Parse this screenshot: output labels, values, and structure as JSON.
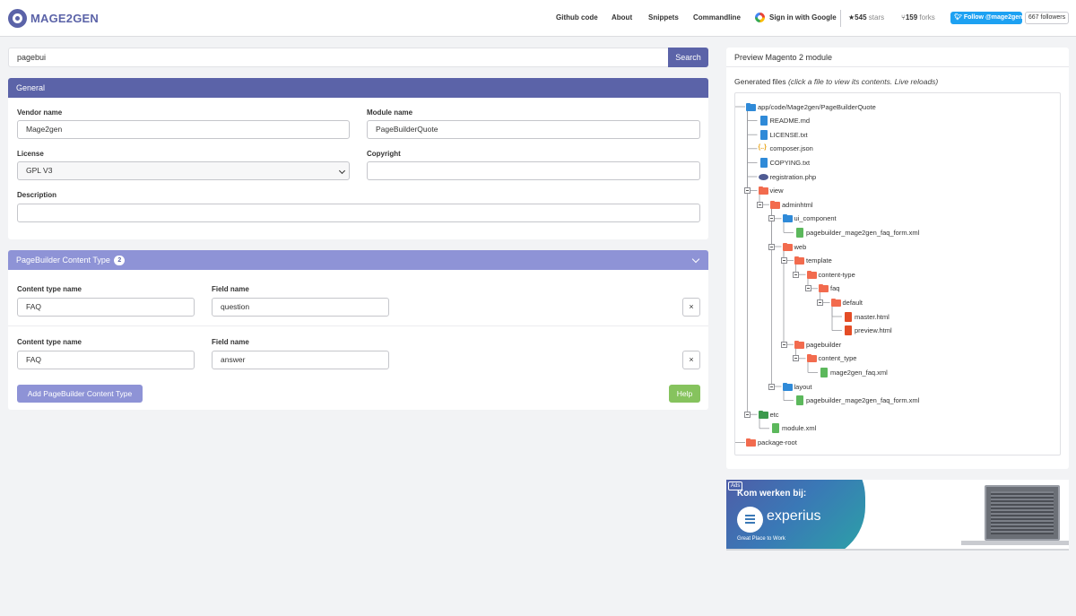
{
  "navbar": {
    "brand": "MAGE2GEN",
    "links": [
      "Github code",
      "About",
      "Snippets",
      "Commandline"
    ],
    "google_signin": "Sign in with Google",
    "stars_count": "545",
    "stars_label": "stars",
    "forks_count": "159",
    "forks_label": "forks",
    "twitter_follow": "Follow @mage2gen",
    "followers": "667 followers"
  },
  "search": {
    "value": "pagebui",
    "button": "Search"
  },
  "general": {
    "title": "General",
    "vendor_label": "Vendor name",
    "vendor_value": "Mage2gen",
    "module_label": "Module name",
    "module_value": "PageBuilderQuote",
    "license_label": "License",
    "license_value": "GPL V3",
    "copyright_label": "Copyright",
    "copyright_value": "",
    "description_label": "Description",
    "description_value": ""
  },
  "pagebuilder": {
    "title": "PageBuilder Content Type",
    "count": "2",
    "rows": [
      {
        "content_type_label": "Content type name",
        "content_type_value": "FAQ",
        "field_label": "Field name",
        "field_value": "question",
        "remove": "×"
      },
      {
        "content_type_label": "Content type name",
        "content_type_value": "FAQ",
        "field_label": "Field name",
        "field_value": "answer",
        "remove": "×"
      }
    ],
    "add_button": "Add PageBuilder Content Type",
    "help_button": "Help"
  },
  "preview": {
    "title": "Preview Magento 2 module",
    "generated_prefix": "Generated files",
    "generated_hint": "(click a file to view its contents. Live reloads)",
    "tree": [
      {
        "name": "app/code/Mage2gen/PageBuilderQuote",
        "icon": "folder-blue-icon"
      },
      {
        "name": "README.md",
        "icon": "file-icon"
      },
      {
        "name": "LICENSE.txt",
        "icon": "file-icon"
      },
      {
        "name": "composer.json",
        "icon": "json-file-icon"
      },
      {
        "name": "COPYING.txt",
        "icon": "file-icon"
      },
      {
        "name": "registration.php",
        "icon": "php-file-icon"
      },
      {
        "name": "view",
        "icon": "folder-orange-icon"
      },
      {
        "name": "adminhtml",
        "icon": "folder-orange-icon"
      },
      {
        "name": "ui_component",
        "icon": "folder-blue-icon"
      },
      {
        "name": "pagebuilder_mage2gen_faq_form.xml",
        "icon": "xml-file-icon"
      },
      {
        "name": "web",
        "icon": "folder-orange-icon"
      },
      {
        "name": "template",
        "icon": "folder-orange-icon"
      },
      {
        "name": "content-type",
        "icon": "folder-orange-icon"
      },
      {
        "name": "faq",
        "icon": "folder-orange-icon"
      },
      {
        "name": "default",
        "icon": "folder-orange-icon"
      },
      {
        "name": "master.html",
        "icon": "html-file-icon"
      },
      {
        "name": "preview.html",
        "icon": "html-file-icon"
      },
      {
        "name": "pagebuilder",
        "icon": "folder-orange-icon"
      },
      {
        "name": "content_type",
        "icon": "folder-orange-icon"
      },
      {
        "name": "mage2gen_faq.xml",
        "icon": "xml-file-icon"
      },
      {
        "name": "layout",
        "icon": "folder-blue-icon"
      },
      {
        "name": "pagebuilder_mage2gen_faq_form.xml",
        "icon": "xml-file-icon"
      },
      {
        "name": "etc",
        "icon": "folder-green-icon"
      },
      {
        "name": "module.xml",
        "icon": "xml-file-icon"
      },
      {
        "name": "package-root",
        "icon": "folder-orange-icon"
      }
    ]
  },
  "ad": {
    "tag": "Ads",
    "headline": "Kom werken bij:",
    "brand": "experius",
    "tagline": "Great Place to Work"
  },
  "colors": {
    "primary": "#5b63a8",
    "secondary_header": "#8e93d6",
    "help_green": "#86c35e",
    "add_button": "#8e93d6",
    "folder_orange": "#f26b4e",
    "folder_blue": "#2f8ad8"
  }
}
